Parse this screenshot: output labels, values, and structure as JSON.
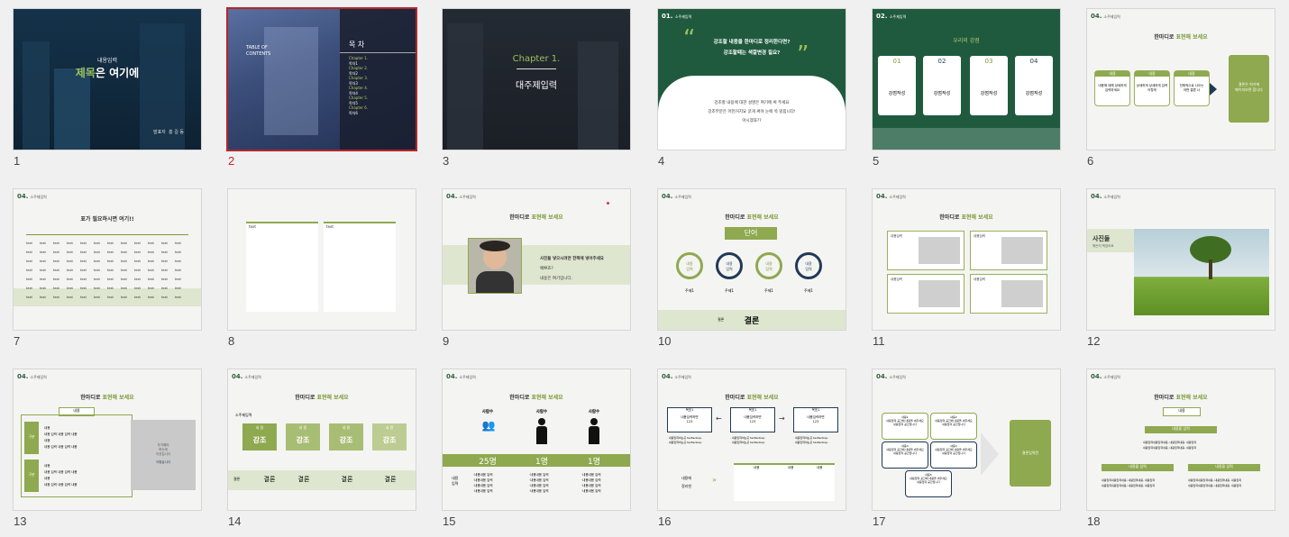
{
  "slides": {
    "s1": {
      "num": "1",
      "sub": "내용입력",
      "title_a": "제목",
      "title_b": "은 여기에",
      "presenter_label": "발표자",
      "presenter": "홍 길 동"
    },
    "s2": {
      "num": "2",
      "left": "TABLE OF\nCONTENTS",
      "title": "목 차",
      "items": [
        {
          "chapter": "Chapter 1.",
          "name": "목차1"
        },
        {
          "chapter": "Chapter 2.",
          "name": "목차2"
        },
        {
          "chapter": "Chapter 3.",
          "name": "목차3"
        },
        {
          "chapter": "Chapter 4.",
          "name": "목차4"
        },
        {
          "chapter": "Chapter 5.",
          "name": "목차5"
        },
        {
          "chapter": "Chapter 6.",
          "name": "목차6"
        }
      ]
    },
    "s3": {
      "num": "3",
      "chapter": "Chapter 1.",
      "title": "대주제입력"
    },
    "s4": {
      "num": "4",
      "hdr": "01.",
      "hdr_sub": "소주제입력",
      "q1": "강조할 내용을 한마디로 정리한다면?",
      "q2": "강조할때는 색깔변경 필요?",
      "b1": "강조할 내용에 대한 설명은 여기에 써 주세요",
      "b2": "강조부분은 어떤거지요 굵게 써야 눈에 쏙 읽힙니다!",
      "b3": "아시겠죠??"
    },
    "s5": {
      "num": "5",
      "hdr": "02.",
      "hdr_sub": "소주제입력",
      "title": "우리의 강점",
      "cards": [
        {
          "n": "01",
          "t": "강점작성"
        },
        {
          "n": "02",
          "t": "강점작성"
        },
        {
          "n": "03",
          "t": "강점작성"
        },
        {
          "n": "04",
          "t": "강점작성"
        }
      ]
    },
    "s6": {
      "num": "6",
      "hdr": "04.",
      "hdr_sub": "소주제입력",
      "title_a": "한마디로",
      "title_b": "표현해 보세요",
      "boxes": [
        {
          "h": "내용",
          "b": "내용에 대해 상세하게\n입력하세요"
        },
        {
          "h": "내용",
          "b": "상세하게 상세하게 입력\n이렇게"
        },
        {
          "h": "내용",
          "b": "전체적으로 나오는\n어떤 결론 나"
        }
      ],
      "result": "결론은 여기에\n페이지보면 합니다"
    },
    "s7": {
      "num": "7",
      "hdr": "04.",
      "hdr_sub": "소주제입력",
      "title": "표가 필요하시면 여기!!",
      "col": "text",
      "cell": "text"
    },
    "s8": {
      "num": "8",
      "cell": "text"
    },
    "s9": {
      "num": "9",
      "hdr": "04.",
      "hdr_sub": "소주제입력",
      "title_a": "한마디로",
      "title_b": "표현해 보세요",
      "l1": "사진들 넣으시려면 한쪽에 넣어주세요",
      "l2": "예쁘죠?",
      "l3": "내용은 여기입니다."
    },
    "s10": {
      "num": "10",
      "hdr": "04.",
      "hdr_sub": "소주제입력",
      "title_a": "한마디로",
      "title_b": "표현해 보세요",
      "word": "단어",
      "circles": [
        {
          "t": "내용\n입력",
          "cap": "주제1"
        },
        {
          "t": "내용\n입력",
          "cap": "주제1"
        },
        {
          "t": "내용\n입력",
          "cap": "주제1"
        },
        {
          "t": "내용\n입력",
          "cap": "주제1"
        }
      ],
      "concl_label": "결론",
      "concl": "결론"
    },
    "s11": {
      "num": "11",
      "hdr": "04.",
      "hdr_sub": "소주제입력",
      "title_a": "한마디로",
      "title_b": "표현해 보세요",
      "list_title": "내용입력",
      "item": "내용"
    },
    "s12": {
      "num": "12",
      "hdr": "04.",
      "hdr_sub": "소주제입력",
      "label": "사진들",
      "sub": "뭐든지 찍었어요"
    },
    "s13": {
      "num": "13",
      "hdr": "04.",
      "hdr_sub": "소주제입력",
      "title_a": "한마디로",
      "title_b": "표현해 보세요",
      "head": "내용",
      "g1": "구분",
      "g2": "구분",
      "r": "내용",
      "d": "내용 입력 내용 입력 내용",
      "side": "추가해야\n하는데\n이것입니다",
      "side2": "이렇습니다"
    },
    "s14": {
      "num": "14",
      "hdr": "04.",
      "hdr_sub": "소주제입력",
      "title_a": "한마디로",
      "title_b": "표현해 보세요",
      "small": "소주제입력",
      "arrows": [
        {
          "top": "내 용",
          "mid": "강조"
        },
        {
          "top": "내 용",
          "mid": "강조"
        },
        {
          "top": "내 용",
          "mid": "강조"
        },
        {
          "top": "내 용",
          "mid": "강조"
        }
      ],
      "row_label": "결론",
      "concl": "결론"
    },
    "s15": {
      "num": "15",
      "hdr": "04.",
      "hdr_sub": "소주제입력",
      "title_a": "한마디로",
      "title_b": "표현해 보세요",
      "cols": [
        {
          "h": "사람수",
          "v": "25명"
        },
        {
          "h": "사람수",
          "v": "1명"
        },
        {
          "h": "사람수",
          "v": "1명"
        }
      ],
      "left": "내용\n입력",
      "bullet": "·내용내용 입력"
    },
    "s16": {
      "num": "16",
      "hdr": "04.",
      "hdr_sub": "소주제입력",
      "title_a": "한마디로",
      "title_b": "표현해 보세요",
      "boxes": [
        {
          "h": "목표1",
          "b": "내용입력하면\n123"
        },
        {
          "h": "목표1",
          "b": "내용입력하면\n123"
        },
        {
          "h": "목표1",
          "b": "내용입력하면\n123"
        }
      ],
      "bullet": "· 내용입력하는곳 text&nbsp;",
      "side": "내용에\n정리한",
      "th": "내용"
    },
    "s17": {
      "num": "17",
      "hdr": "04.",
      "hdr_sub": "소주제입력",
      "boxes": [
        {
          "h": "내용1",
          "b": "내용입력 공간에 내용을 써주세요\n내용입력 공간입니다"
        },
        {
          "h": "내용2",
          "b": "내용입력 공간에 내용을 써주세요\n내용입력 공간입니다"
        },
        {
          "h": "내용3",
          "b": "내용입력 공간에 내용을 써주세요\n내용입력 공간입니다"
        },
        {
          "h": "내용4",
          "b": "내용입력 공간에 내용을 써주세요\n내용입력 공간입니다"
        },
        {
          "h": "내용5",
          "b": "내용입력 공간에 내용을 써주세요\n내용입력 공간입니다"
        }
      ],
      "result": "결론입력란"
    },
    "s18": {
      "num": "18",
      "hdr": "04.",
      "hdr_sub": "소주제입력",
      "title_a": "한마디로",
      "title_b": "표현해 보세요",
      "top": "내용",
      "bar1": "내용을 입력",
      "bar2": "내용을 입력",
      "bar3": "내용을 입력",
      "line": "내용입력내용입력내용, 내용입력내용, 내용입력"
    }
  },
  "colors": {
    "accent": "#8ea94f",
    "dark_green": "#1f5a3f",
    "select": "#b5262d"
  }
}
